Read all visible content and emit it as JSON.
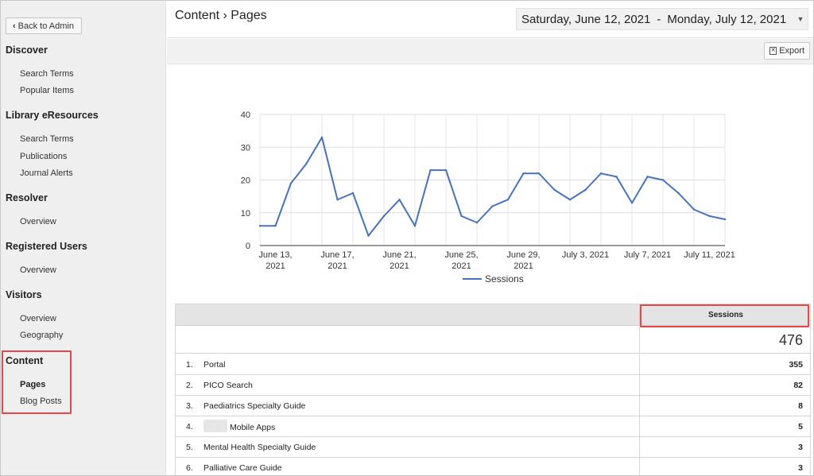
{
  "sidebar": {
    "back_label": "Back to Admin",
    "sections": {
      "discover": {
        "title": "Discover",
        "items": [
          "Search Terms",
          "Popular Items"
        ]
      },
      "library": {
        "title": "Library eResources",
        "items": [
          "Search Terms",
          "Publications",
          "Journal Alerts"
        ]
      },
      "resolver": {
        "title": "Resolver",
        "items": [
          "Overview"
        ]
      },
      "registered": {
        "title": "Registered Users",
        "items": [
          "Overview"
        ]
      },
      "visitors": {
        "title": "Visitors",
        "items": [
          "Overview",
          "Geography"
        ]
      },
      "content": {
        "title": "Content",
        "items": [
          "Pages",
          "Blog Posts"
        ],
        "active": "Pages"
      }
    }
  },
  "header": {
    "title": "Content › Pages",
    "date_start": "Saturday, June 12, 2021",
    "date_sep": "-",
    "date_end": "Monday, July 12, 2021"
  },
  "toolbar": {
    "export_label": "Export"
  },
  "chart_data": {
    "type": "line",
    "series": [
      {
        "name": "Sessions",
        "color": "#4472c4",
        "x": [
          "2021-06-12",
          "2021-06-13",
          "2021-06-14",
          "2021-06-15",
          "2021-06-16",
          "2021-06-17",
          "2021-06-18",
          "2021-06-19",
          "2021-06-20",
          "2021-06-21",
          "2021-06-22",
          "2021-06-23",
          "2021-06-24",
          "2021-06-25",
          "2021-06-26",
          "2021-06-27",
          "2021-06-28",
          "2021-06-29",
          "2021-06-30",
          "2021-07-01",
          "2021-07-02",
          "2021-07-03",
          "2021-07-04",
          "2021-07-05",
          "2021-07-06",
          "2021-07-07",
          "2021-07-08",
          "2021-07-09",
          "2021-07-10",
          "2021-07-11",
          "2021-07-12"
        ],
        "values": [
          6,
          6,
          19,
          25,
          33,
          14,
          16,
          3,
          9,
          14,
          6,
          23,
          23,
          9,
          7,
          12,
          14,
          22,
          22,
          17,
          14,
          17,
          22,
          21,
          13,
          21,
          20,
          16,
          11,
          9,
          8
        ]
      }
    ],
    "y_ticks": [
      0,
      10,
      20,
      30,
      40
    ],
    "ylim": [
      0,
      40
    ],
    "x_tick_labels": [
      {
        "date": "2021-06-13",
        "line1": "June 13,",
        "line2": "2021"
      },
      {
        "date": "2021-06-17",
        "line1": "June 17,",
        "line2": "2021"
      },
      {
        "date": "2021-06-21",
        "line1": "June 21,",
        "line2": "2021"
      },
      {
        "date": "2021-06-25",
        "line1": "June 25,",
        "line2": "2021"
      },
      {
        "date": "2021-06-29",
        "line1": "June 29,",
        "line2": "2021"
      },
      {
        "date": "2021-07-03",
        "line1": "July 3, 2021",
        "line2": ""
      },
      {
        "date": "2021-07-07",
        "line1": "July 7, 2021",
        "line2": ""
      },
      {
        "date": "2021-07-11",
        "line1": "July 11, 2021",
        "line2": ""
      }
    ],
    "legend": "bottom",
    "grid": true
  },
  "table": {
    "col_sessions": "Sessions",
    "total": "476",
    "rows": [
      {
        "idx": "1.",
        "page": "Portal",
        "sessions": "355"
      },
      {
        "idx": "2.",
        "page": "PICO Search",
        "sessions": "82"
      },
      {
        "idx": "3.",
        "page": "Paediatrics Specialty Guide",
        "sessions": "8"
      },
      {
        "idx": "4.",
        "page": "Mobile Apps",
        "sessions": "5"
      },
      {
        "idx": "5.",
        "page": "Mental Health Specialty Guide",
        "sessions": "3"
      },
      {
        "idx": "6.",
        "page": "Palliative Care Guide",
        "sessions": "3"
      }
    ]
  },
  "colors": {
    "accent_line": "#4472c4",
    "highlight": "#e8474a"
  }
}
